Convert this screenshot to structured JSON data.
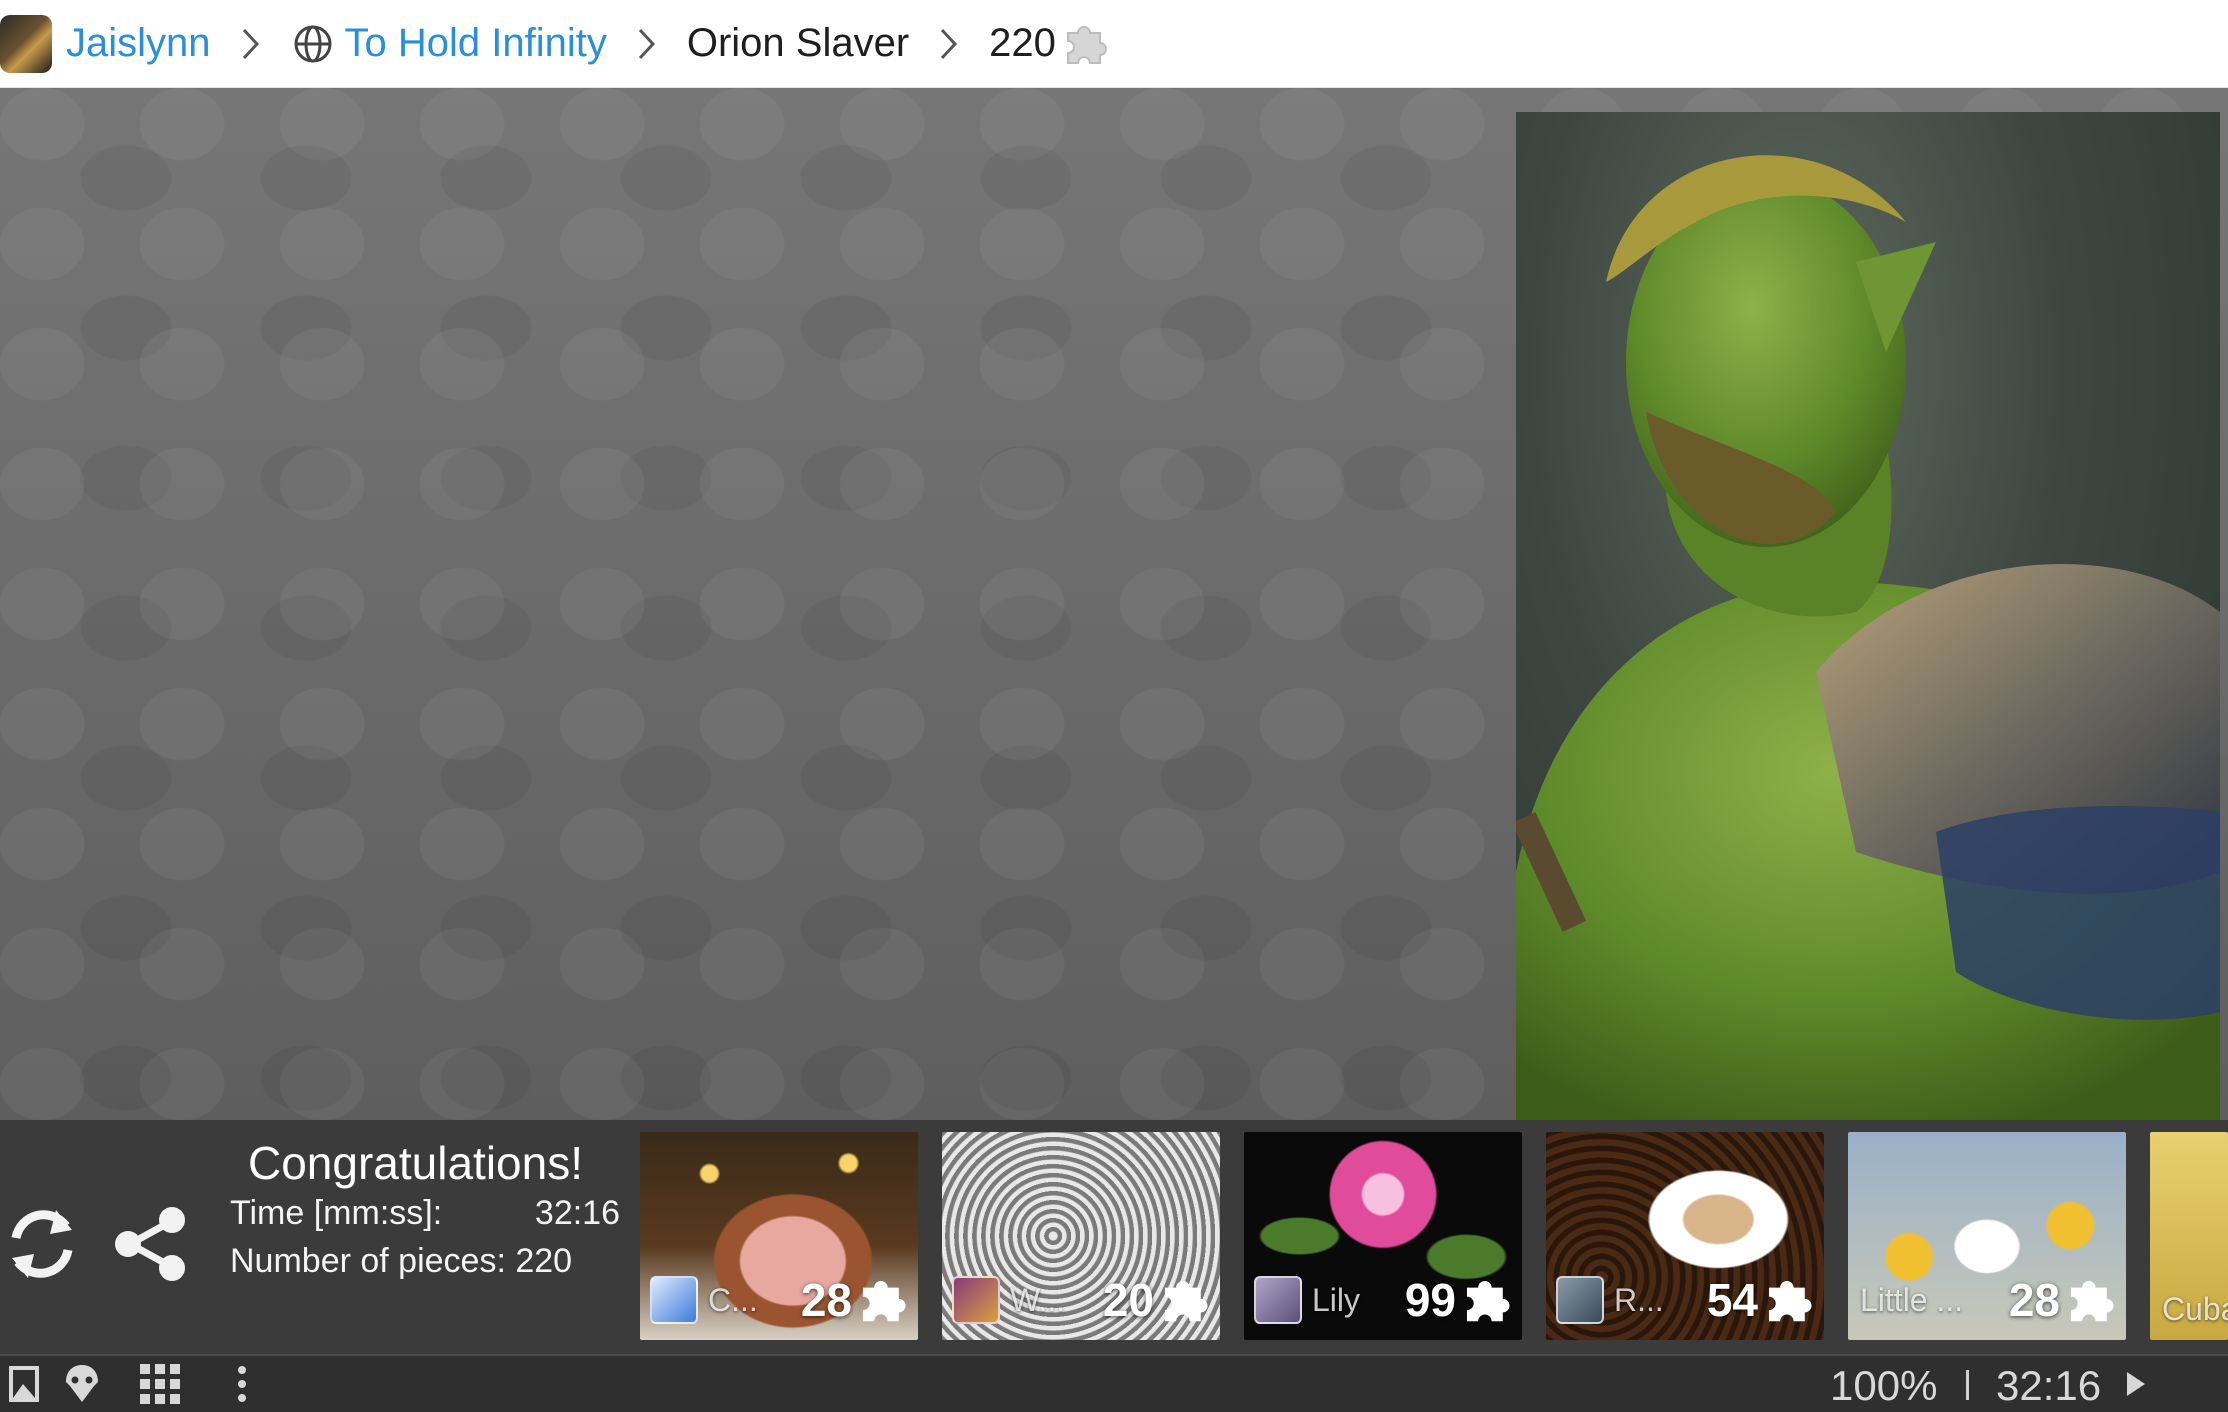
{
  "breadcrumb": {
    "user": "Jaislynn",
    "collection": "To Hold Infinity",
    "puzzle": "Orion Slaver",
    "pieces": "220"
  },
  "congrats": {
    "title": "Congratulations!",
    "time_label": "Time [mm:ss]:",
    "time_value": "32:16",
    "pieces_label": "Number of pieces: 220"
  },
  "thumbnails": [
    {
      "name": "C...",
      "count": "28"
    },
    {
      "name": "W...",
      "count": "20"
    },
    {
      "name": "Lily",
      "count": "99"
    },
    {
      "name": "R...",
      "count": "54"
    },
    {
      "name": "Little ...",
      "count": "28"
    },
    {
      "name": "Cuba",
      "count": ""
    }
  ],
  "statusbar": {
    "zoom": "100%",
    "time": "32:16"
  },
  "colors": {
    "link": "#2a8fd8",
    "board": "#727272",
    "panel": "#3b3b3b",
    "statusbar": "#2f2f2f"
  },
  "icons": [
    "user-avatar",
    "chevron-right-icon",
    "globe-icon",
    "puzzle-piece-icon",
    "refresh-icon",
    "share-icon",
    "preview-image-icon",
    "ghost-icon",
    "grid-icon",
    "more-vertical-icon",
    "play-icon"
  ]
}
